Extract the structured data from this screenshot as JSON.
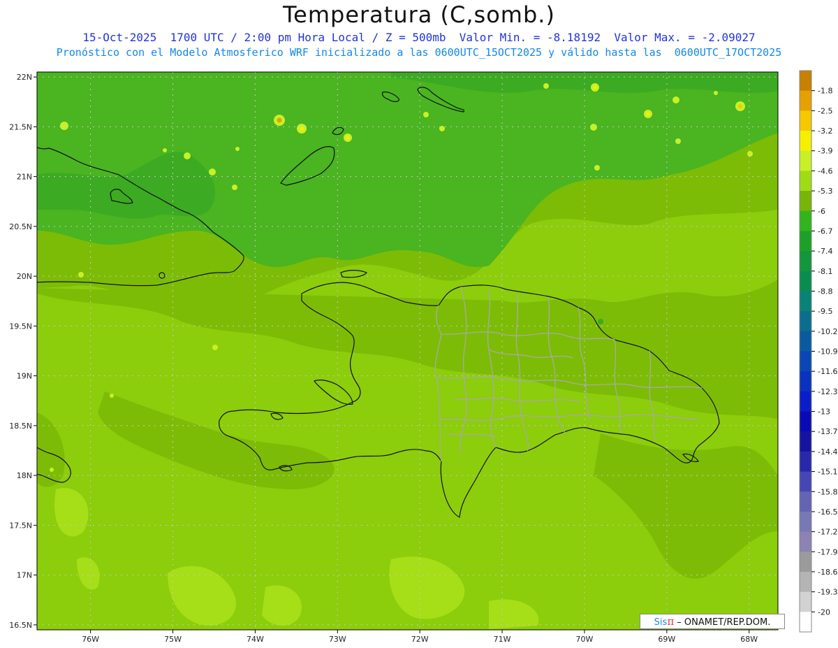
{
  "title": "Temperatura (C,somb.)",
  "subtitle1": "15-Oct-2025  1700 UTC / 2:00 pm Hora Local / Z = 500mb  Valor Min. = -8.18192  Valor Max. = -2.09027",
  "subtitle2": "Pronóstico con el Modelo Atmosferico WRF inicializado a las 0600UTC_15OCT2025 y válido hasta las  0600UTC_17OCT2025",
  "credit": {
    "sis": "Sis",
    "pi": "π",
    "org": " – ONAMET/REP.DOM."
  },
  "map": {
    "lat_labels": [
      "22N",
      "21.5N",
      "21N",
      "20.5N",
      "20N",
      "19.5N",
      "19N",
      "18.5N",
      "18N",
      "17.5N",
      "17N",
      "16.5N"
    ],
    "lon_labels": [
      "76W",
      "75W",
      "74W",
      "73W",
      "72W",
      "71W",
      "70W",
      "69W",
      "68W"
    ],
    "colors": {
      "frame": "#000000",
      "grid": "#c8c8c8",
      "coast": "#111111",
      "provinces": "#a9a9a9"
    }
  },
  "chart_data": {
    "type": "heatmap",
    "title": "Temperatura (C,somb.)",
    "xlabel": "",
    "ylabel": "",
    "xlim": [
      -76.65,
      -67.65
    ],
    "ylim": [
      16.45,
      22.05
    ],
    "grid": true,
    "legend_placement": "right",
    "value_min": -8.18192,
    "value_max": -2.09027,
    "colorbar_labels": [
      "-1.8",
      "-2.5",
      "-3.2",
      "-3.9",
      "-4.6",
      "-5.3",
      "-6",
      "-6.7",
      "-7.4",
      "-8.1",
      "-8.8",
      "-9.5",
      "-10.2",
      "-10.9",
      "-11.6",
      "-12.3",
      "-13",
      "-13.7",
      "-14.4",
      "-15.1",
      "-15.8",
      "-16.5",
      "-17.2",
      "-17.9",
      "-18.6",
      "-19.3",
      "-20"
    ],
    "colorbar_colors": [
      "#c88000",
      "#e6a000",
      "#f5c800",
      "#f5f000",
      "#c8f028",
      "#a0dc14",
      "#78b40a",
      "#32b41e",
      "#1ea028",
      "#14963c",
      "#0a8c50",
      "#0a8278",
      "#0a6e8c",
      "#0a5aa0",
      "#0a46b4",
      "#0a32be",
      "#0a1ec8",
      "#0a0ab4",
      "#1414a0",
      "#2828aa",
      "#4646b4",
      "#6464b4",
      "#7878b4",
      "#8c82b4",
      "#9b9b9b",
      "#b4b4b4",
      "#d2d2d2",
      "#ffffff"
    ]
  }
}
